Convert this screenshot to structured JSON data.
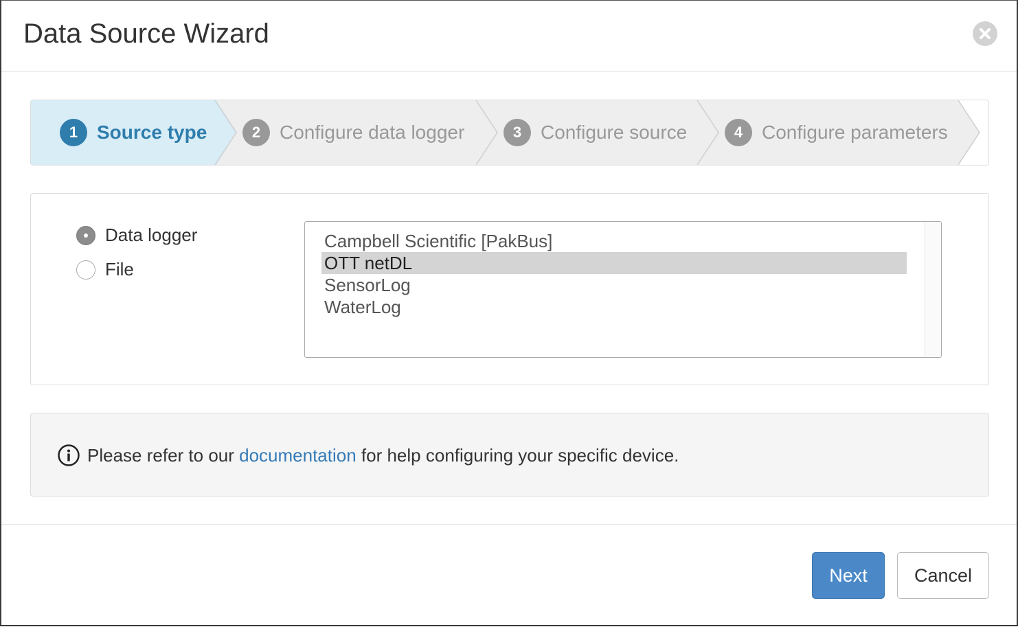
{
  "dialog": {
    "title": "Data Source Wizard",
    "close_icon": "close-icon"
  },
  "steps": [
    {
      "number": "1",
      "label": "Source type",
      "active": true
    },
    {
      "number": "2",
      "label": "Configure data logger",
      "active": false
    },
    {
      "number": "3",
      "label": "Configure source",
      "active": false
    },
    {
      "number": "4",
      "label": "Configure parameters",
      "active": false
    }
  ],
  "source_type": {
    "options": [
      {
        "label": "Data logger",
        "checked": true
      },
      {
        "label": "File",
        "checked": false
      }
    ]
  },
  "logger_list": {
    "items": [
      "Campbell Scientific [PakBus]",
      "OTT netDL",
      "SensorLog",
      "WaterLog"
    ],
    "selected": "OTT netDL"
  },
  "info": {
    "icon": "info-icon",
    "prefix": "Please refer to our ",
    "link_text": "documentation",
    "suffix": " for help configuring your specific device."
  },
  "footer": {
    "next_label": "Next",
    "cancel_label": "Cancel"
  },
  "colors": {
    "accent": "#2e7dad",
    "active_step_bg": "#d9edf7",
    "primary_button": "#4a88c8",
    "link": "#337ab7"
  }
}
